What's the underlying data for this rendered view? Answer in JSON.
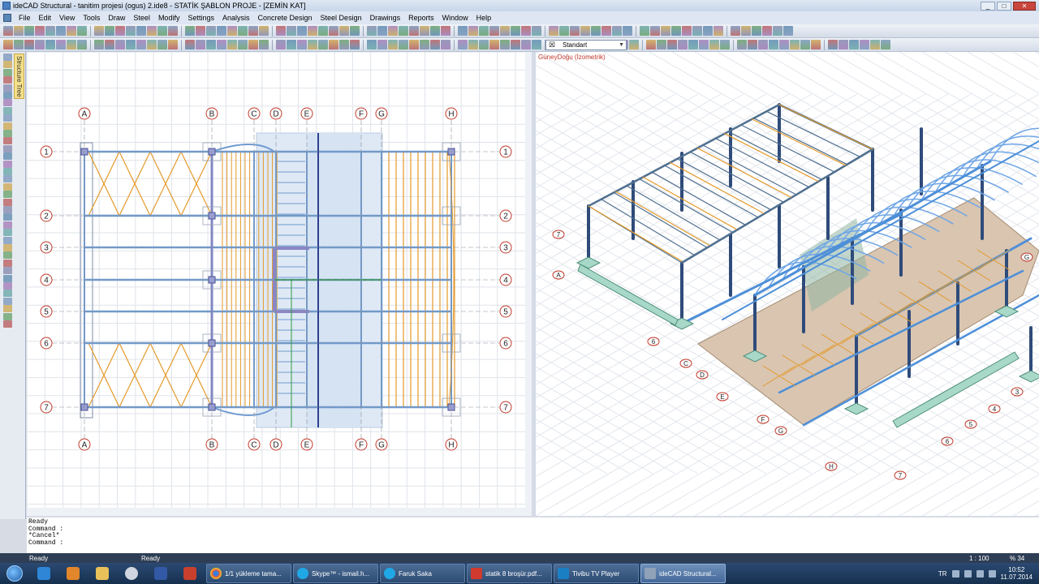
{
  "window": {
    "title": "ideCAD Structural - tanitim projesi (ogus) 2.ide8 - STATİK ŞABLON PROJE - [ZEMİN KAT]"
  },
  "menu": [
    "File",
    "Edit",
    "View",
    "Tools",
    "Draw",
    "Steel",
    "Modify",
    "Settings",
    "Analysis",
    "Concrete Design",
    "Steel Design",
    "Drawings",
    "Reports",
    "Window",
    "Help"
  ],
  "toolbar": {
    "style_select": "Standart"
  },
  "sidebar": {
    "tree_tab": "Structure Tree"
  },
  "plan": {
    "axes_x": [
      "A",
      "B",
      "C",
      "D",
      "E",
      "F",
      "G",
      "H"
    ],
    "axes_y": [
      "1",
      "2",
      "3",
      "4",
      "5",
      "6",
      "7"
    ]
  },
  "iso": {
    "view_label": "GüneyDoğu (İzometrik)",
    "axes_left": [
      "7",
      "A",
      "6",
      "C",
      "D",
      "E",
      "F",
      "G"
    ],
    "axes_right": [
      "G",
      "3",
      "4",
      "5",
      "6",
      "H",
      "7"
    ]
  },
  "command": {
    "lines": [
      "Ready",
      "Command :",
      "*Cancel*",
      "Command :"
    ]
  },
  "status": {
    "left": "Ready",
    "mid": "Ready",
    "scale": "1 : 100",
    "zoom": "% 34"
  },
  "taskbar": {
    "tasks": [
      "1/1 yükleme tama...",
      "Skype™ - ismail.h...",
      "Faruk Saka",
      "statik 8 broşür.pdf...",
      "Tivibu TV Player",
      "ideCAD Structural..."
    ],
    "lang": "TR",
    "time": "10:52",
    "date": "11.07.2014"
  },
  "colors": {
    "accent": "#2e3e55",
    "gridline": "#c9ced6",
    "orange": "#e49a2a",
    "blue": "#4d8fd8",
    "axis_red": "#c0392b"
  }
}
